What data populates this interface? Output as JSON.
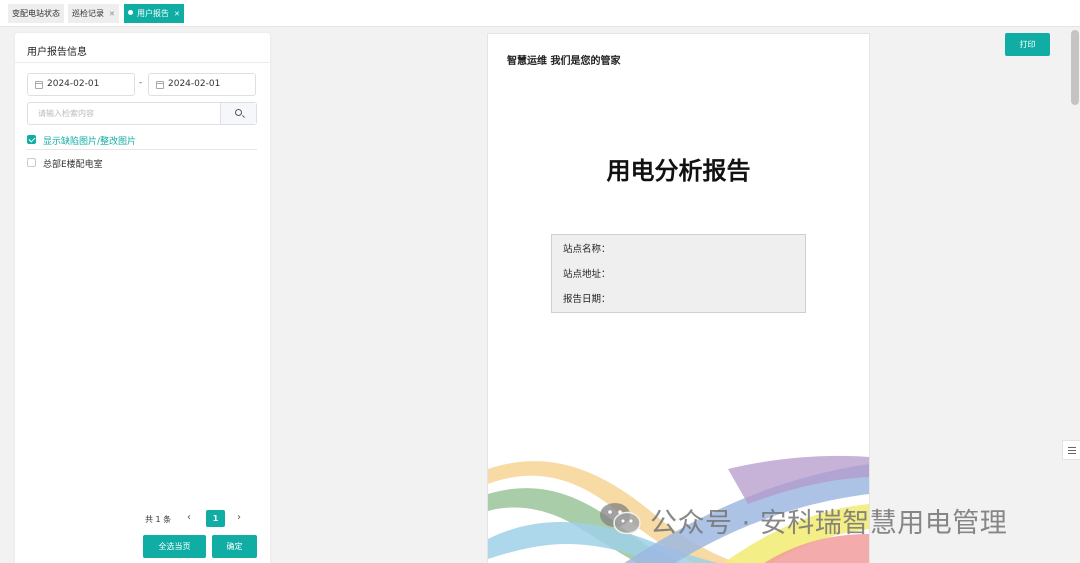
{
  "tabs": [
    {
      "label": "变配电站状态",
      "closable": false,
      "active": false
    },
    {
      "label": "巡检记录",
      "closable": true,
      "active": false
    },
    {
      "label": "用户报告",
      "closable": true,
      "active": true
    }
  ],
  "left_panel": {
    "title": "用户报告信息",
    "start_date": "2024-02-01",
    "date_separator": "-",
    "end_date": "2024-02-01",
    "search_placeholder": "请输入检索内容",
    "show_defect_images": {
      "label": "显示缺陷图片/整改图片",
      "checked": true
    },
    "stations": [
      {
        "label": "总部E楼配电室",
        "checked": false
      }
    ],
    "pager": {
      "total": "共 1 条",
      "prev": "‹",
      "current": "1",
      "next": "›"
    },
    "select_all_button": "全选当页",
    "confirm_button": "确定"
  },
  "report": {
    "slogan": "智慧运维 我们是您的管家",
    "title": "用电分析报告",
    "fields": [
      {
        "label": "站点名称："
      },
      {
        "label": "站点地址："
      },
      {
        "label": "报告日期："
      }
    ]
  },
  "print_button": "打印",
  "watermark": {
    "text": "公众号 · 安科瑞智慧用电管理",
    "icon": "wechat-icon"
  },
  "colors": {
    "accent": "#0fada3",
    "background": "#f2f2f2"
  }
}
